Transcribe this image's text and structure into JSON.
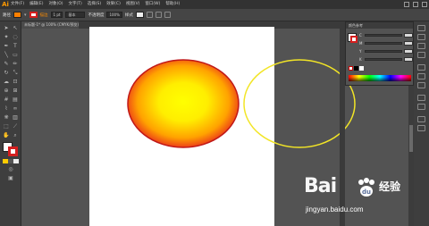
{
  "app": {
    "logo": "Ai"
  },
  "menu": {
    "items": [
      "文件(F)",
      "编辑(E)",
      "对象(O)",
      "文字(T)",
      "选择(S)",
      "效果(C)",
      "视图(V)",
      "窗口(W)",
      "帮助(H)"
    ]
  },
  "control_bar": {
    "object_type": "路径",
    "stroke_weight": "1 pt",
    "brush_label": "基本",
    "opacity_label": "不透明度",
    "opacity_value": "100%",
    "style_label": "样式",
    "stroke_link": "描边",
    "colors": {
      "fill": "#ff8000",
      "stroke": "#d41f1f"
    }
  },
  "document_tab": {
    "label": "未标题-1* @ 100% (CMYK/预览)"
  },
  "color_panel": {
    "title": "颜色参考",
    "channels": [
      "C",
      "M",
      "Y",
      "K"
    ],
    "spectrum_colors": [
      "#ff0000",
      "#ffff00",
      "#00ff00",
      "#00ffff",
      "#0000ff",
      "#ff00ff"
    ]
  },
  "artwork": {
    "ellipse_gradient": {
      "inner": "#ffff00",
      "mid": "#ffcc00",
      "outer": "#e8251f"
    },
    "outline_ellipse": {
      "stroke": "#f2e526"
    }
  },
  "watermark": {
    "brand": "Bai",
    "brand_suffix": "经验",
    "url": "jingyan.baidu.com"
  }
}
